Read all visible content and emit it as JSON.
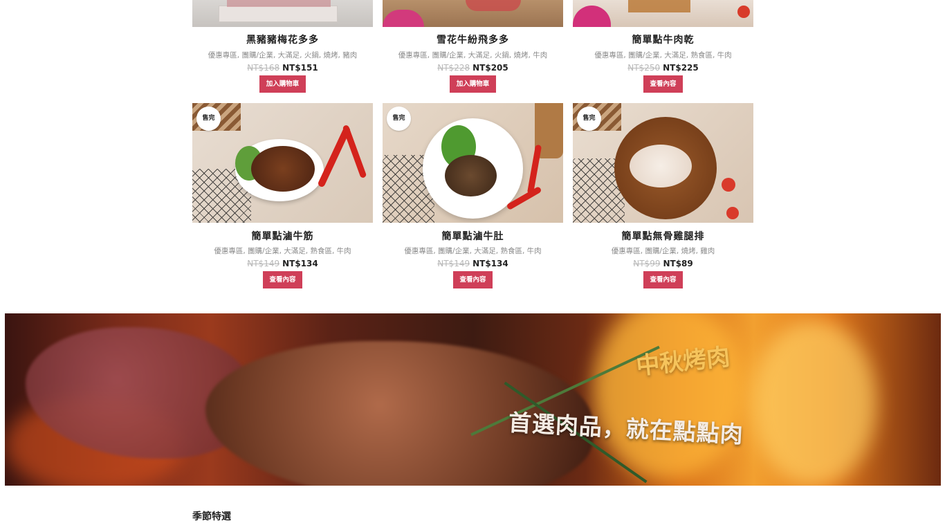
{
  "products": [
    {
      "title": "黑豬豬梅花多多",
      "categories": "優惠專區, 團購/企業, 大滿足, 火鍋, 燒烤, 豬肉",
      "old_price": "NT$168",
      "price": "NT$151",
      "button": "加入購物車",
      "badge": ""
    },
    {
      "title": "雪花牛紛飛多多",
      "categories": "優惠專區, 團購/企業, 大滿足, 火鍋, 燒烤, 牛肉",
      "old_price": "NT$228",
      "price": "NT$205",
      "button": "加入購物車",
      "badge": ""
    },
    {
      "title": "簡單點牛肉乾",
      "categories": "優惠專區, 團購/企業, 大滿足, 熟食區, 牛肉",
      "old_price": "NT$250",
      "price": "NT$225",
      "button": "查看內容",
      "badge": ""
    },
    {
      "title": "簡單點滷牛筋",
      "categories": "優惠專區, 團購/企業, 大滿足, 熟食區, 牛肉",
      "old_price": "NT$149",
      "price": "NT$134",
      "button": "查看內容",
      "badge": "售完"
    },
    {
      "title": "簡單點滷牛肚",
      "categories": "優惠專區, 團購/企業, 大滿足, 熟食區, 牛肉",
      "old_price": "NT$149",
      "price": "NT$134",
      "button": "查看內容",
      "badge": "售完"
    },
    {
      "title": "簡單點無骨雞腿排",
      "categories": "優惠專區, 團購/企業, 燒烤, 雞肉",
      "old_price": "NT$99",
      "price": "NT$89",
      "button": "查看內容",
      "badge": "售完"
    }
  ],
  "banner": {
    "headline": "中秋烤肉",
    "subline": "首選肉品，就在點點肉"
  },
  "next_section": {
    "heading": "季節特選"
  },
  "colors": {
    "button_bg": "#cf3f58",
    "banner_headline": "#f6c45c"
  }
}
